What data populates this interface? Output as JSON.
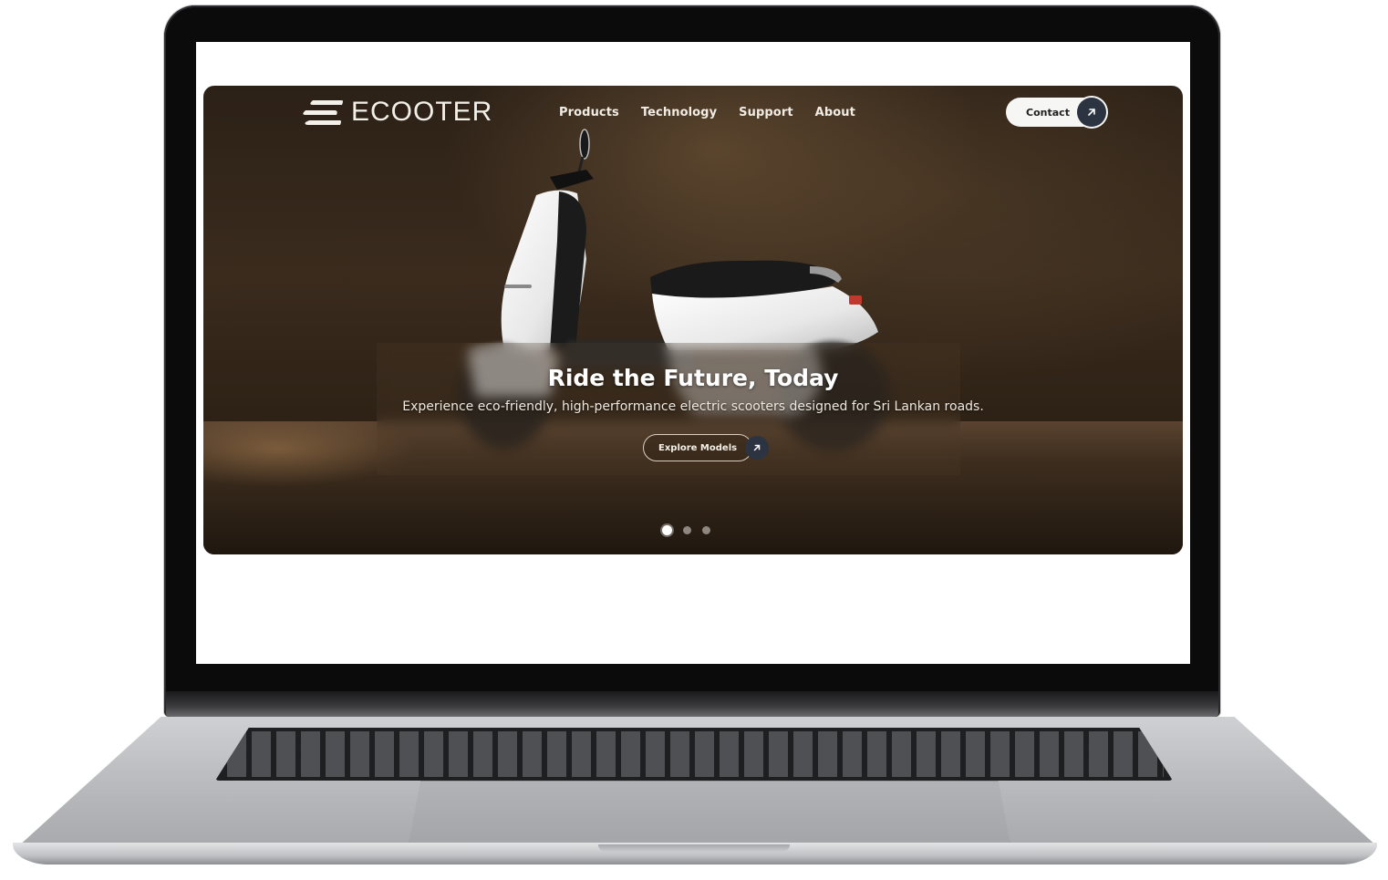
{
  "site": {
    "brand": "ECOOTER",
    "nav": [
      {
        "label": "Products"
      },
      {
        "label": "Technology"
      },
      {
        "label": "Support"
      },
      {
        "label": "About"
      }
    ],
    "contact_label": "Contact"
  },
  "hero": {
    "headline": "Ride the Future, Today",
    "subline": "Experience eco-friendly, high-performance electric scooters designed for Sri Lankan roads.",
    "cta_label": "Explore Models",
    "slides_total": 3,
    "active_slide": 1
  },
  "icons": {
    "contact": "arrow-up-right-icon",
    "cta": "arrow-up-right-icon"
  },
  "colors": {
    "hero_bg": "#3a2b1d",
    "arrow_button": "#2c3442",
    "pill": "#f6f6f4"
  }
}
